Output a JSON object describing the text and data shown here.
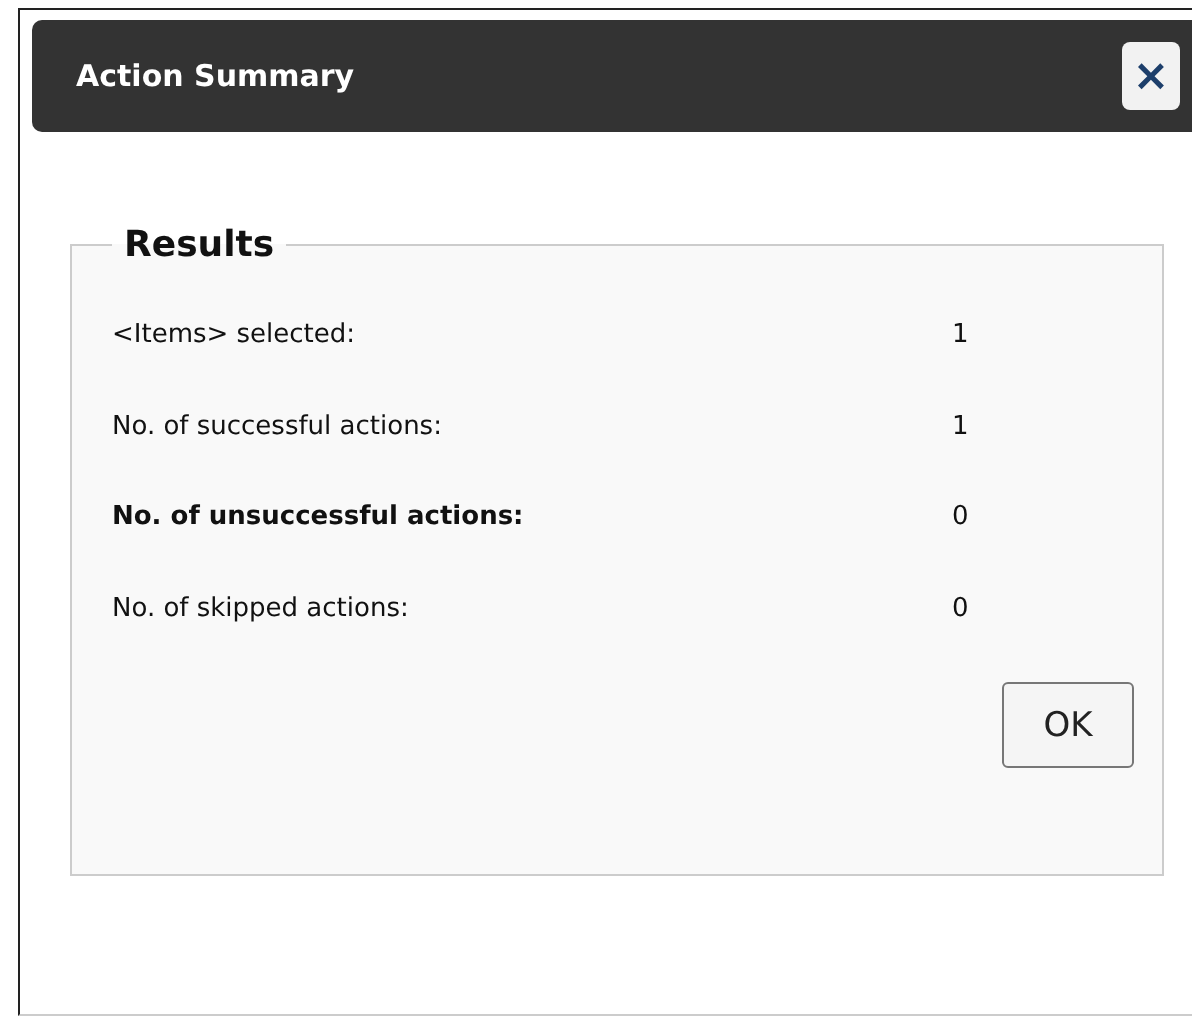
{
  "dialog": {
    "title": "Action Summary",
    "close_label": "×"
  },
  "results": {
    "legend": "Results",
    "rows": [
      {
        "label": "<Items> selected:",
        "value": "1",
        "bold": false
      },
      {
        "label": "No. of successful actions:",
        "value": "1",
        "bold": false
      },
      {
        "label": "No. of unsuccessful actions:",
        "value": "0",
        "bold": true
      },
      {
        "label": "No. of skipped actions:",
        "value": "0",
        "bold": false
      }
    ],
    "button": "OK"
  }
}
